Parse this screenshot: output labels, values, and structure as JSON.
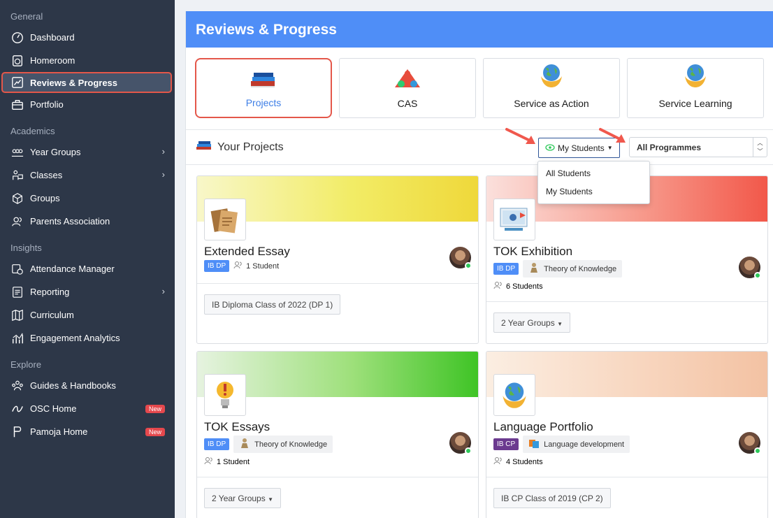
{
  "sidebar": {
    "sections": {
      "general": "General",
      "academics": "Academics",
      "insights": "Insights",
      "explore": "Explore"
    },
    "items": {
      "dashboard": "Dashboard",
      "homeroom": "Homeroom",
      "reviews": "Reviews & Progress",
      "portfolio": "Portfolio",
      "year_groups": "Year Groups",
      "classes": "Classes",
      "groups": "Groups",
      "parents": "Parents Association",
      "attendance": "Attendance Manager",
      "reporting": "Reporting",
      "curriculum": "Curriculum",
      "engagement": "Engagement Analytics",
      "guides": "Guides & Handbooks",
      "osc": "OSC Home",
      "pamoja": "Pamoja Home"
    },
    "new_badge": "New"
  },
  "header": {
    "title": "Reviews & Progress"
  },
  "tabs": {
    "projects": "Projects",
    "cas": "CAS",
    "service_action": "Service as Action",
    "service_learning": "Service Learning"
  },
  "toolbar": {
    "title": "Your Projects",
    "filter": "My Students",
    "programme": "All Programmes"
  },
  "dropdown": {
    "opt1": "All Students",
    "opt2": "My Students"
  },
  "cards": {
    "ee": {
      "title": "Extended Essay",
      "tag": "IB DP",
      "students": "1 Student",
      "footer": "IB Diploma Class of 2022 (DP 1)"
    },
    "tok_ex": {
      "title": "TOK Exhibition",
      "tag": "IB DP",
      "subject": "Theory of Knowledge",
      "students": "6 Students",
      "footer": "2 Year Groups"
    },
    "tok_es": {
      "title": "TOK Essays",
      "tag": "IB DP",
      "subject": "Theory of Knowledge",
      "students": "1 Student",
      "footer": "2 Year Groups"
    },
    "lang": {
      "title": "Language Portfolio",
      "tag": "IB CP",
      "subject": "Language development",
      "students": "4 Students",
      "footer": "IB CP Class of 2019 (CP 2)"
    }
  },
  "colors": {
    "sidebar": "#2d3748",
    "header": "#4f8ef7",
    "highlight": "#e4574a",
    "online": "#2ec95a"
  }
}
